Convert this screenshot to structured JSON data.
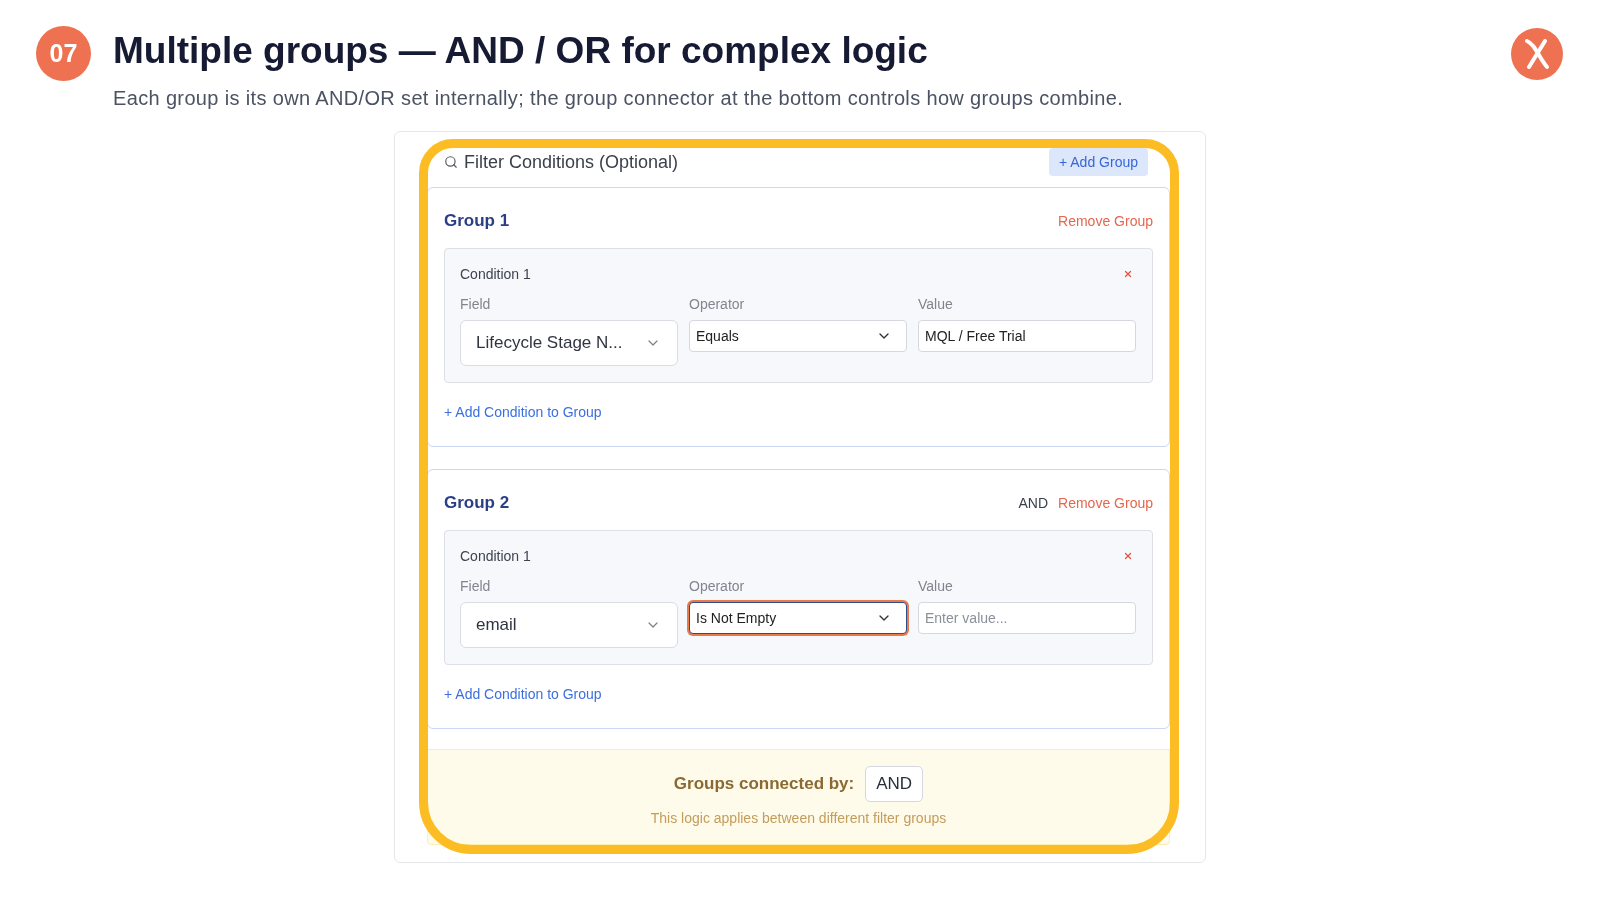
{
  "slide": {
    "number": "07",
    "title": "Multiple groups — AND / OR for complex logic",
    "subtitle": "Each group is its own AND/OR set internally; the group connector at the bottom controls how groups combine."
  },
  "panel": {
    "title": "Filter Conditions (Optional)",
    "add_group_button": "+ Add Group",
    "groups": [
      {
        "title": "Group 1",
        "remove_button": "Remove Group",
        "conditions": [
          {
            "title": "Condition 1",
            "inputs": [
              {
                "label": "Field",
                "kind": "combobox",
                "value": "Lifecycle Stage N...",
                "focused": false
              },
              {
                "label": "Operator",
                "kind": "select",
                "value": "Equals",
                "focused": false
              },
              {
                "label": "Value",
                "kind": "text",
                "value": "MQL / Free Trial",
                "focused": false
              }
            ]
          }
        ],
        "add_condition_link": "+ Add Condition to Group"
      },
      {
        "title": "Group 2",
        "connector": "AND",
        "remove_button": "Remove Group",
        "conditions": [
          {
            "title": "Condition 1",
            "inputs": [
              {
                "label": "Field",
                "kind": "combobox",
                "value": "email",
                "focused": false
              },
              {
                "label": "Operator",
                "kind": "select",
                "value": "Is Not Empty",
                "focused": true
              },
              {
                "label": "Value",
                "kind": "text",
                "placeholder": "Enter value...",
                "focused": false
              }
            ]
          }
        ],
        "add_condition_link": "+ Add Condition to Group"
      }
    ],
    "group_connector": {
      "label": "Groups connected by:",
      "value": "AND",
      "note": "This logic applies between different filter groups"
    }
  }
}
